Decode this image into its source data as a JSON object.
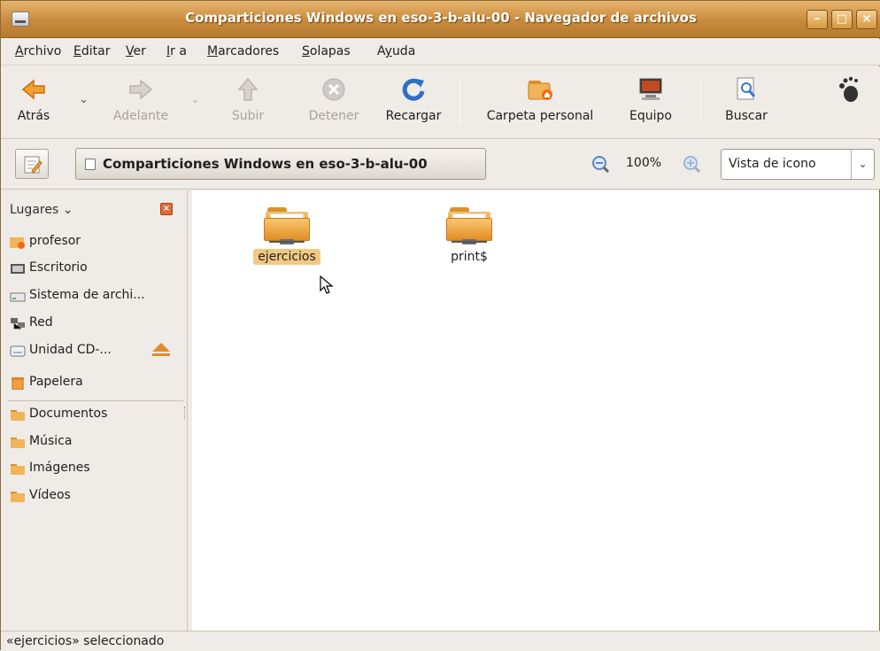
{
  "window": {
    "title": "Comparticiones Windows en eso-3-b-alu-00 - Navegador de archivos",
    "controls": {
      "minimize": "–",
      "maximize": "□",
      "close": "×"
    }
  },
  "menubar": {
    "items": [
      {
        "pre": "",
        "u": "A",
        "post": "rchivo"
      },
      {
        "pre": "",
        "u": "E",
        "post": "ditar"
      },
      {
        "pre": "",
        "u": "V",
        "post": "er"
      },
      {
        "pre": "",
        "u": "I",
        "post": "r a"
      },
      {
        "pre": "",
        "u": "M",
        "post": "arcadores"
      },
      {
        "pre": "",
        "u": "S",
        "post": "olapas"
      },
      {
        "pre": "A",
        "u": "y",
        "post": "uda"
      }
    ]
  },
  "toolbar": {
    "back": "Atrás",
    "forward": "Adelante",
    "up": "Subir",
    "stop": "Detener",
    "reload": "Recargar",
    "home": "Carpeta personal",
    "computer": "Equipo",
    "search": "Buscar"
  },
  "location": {
    "path": "Comparticiones Windows en eso-3-b-alu-00",
    "zoom": "100%",
    "view_mode": "Vista de icono"
  },
  "sidebar": {
    "header": "Lugares",
    "places": [
      "profesor",
      "Escritorio",
      "Sistema de archi...",
      "Red",
      "Unidad CD-..."
    ],
    "trash": "Papelera",
    "bookmarks": [
      "Documentos",
      "Música",
      "Imágenes",
      "Vídeos"
    ]
  },
  "files": [
    {
      "name": "ejercicios",
      "selected": true
    },
    {
      "name": "print$",
      "selected": false
    }
  ],
  "status": "«ejercicios» seleccionado",
  "colors": {
    "accent": "#e48a2c",
    "titlebar": "#c88a3c",
    "selection": "#f3c882"
  }
}
